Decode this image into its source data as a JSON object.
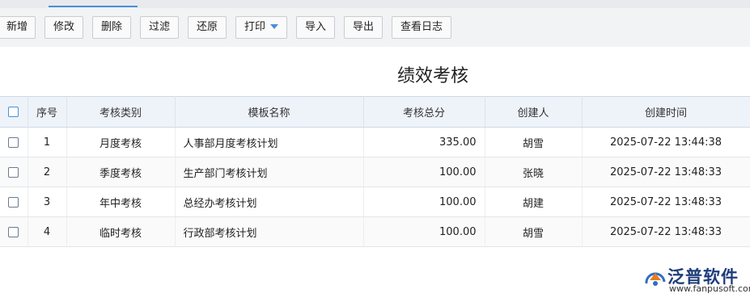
{
  "toolbar": {
    "buttons": [
      "新增",
      "修改",
      "删除",
      "过滤",
      "还原",
      "打印",
      "导入",
      "导出",
      "查看日志"
    ]
  },
  "page": {
    "title": "绩效考核"
  },
  "table": {
    "headers": [
      "序号",
      "考核类别",
      "模板名称",
      "考核总分",
      "创建人",
      "创建时间"
    ],
    "rows": [
      {
        "no": "1",
        "category": "月度考核",
        "template": "人事部月度考核计划",
        "score": "335.00",
        "creator": "胡雪",
        "time": "2025-07-22 13:44:38"
      },
      {
        "no": "2",
        "category": "季度考核",
        "template": "生产部门考核计划",
        "score": "100.00",
        "creator": "张晓",
        "time": "2025-07-22 13:48:33"
      },
      {
        "no": "3",
        "category": "年中考核",
        "template": "总经办考核计划",
        "score": "100.00",
        "creator": "胡建",
        "time": "2025-07-22 13:48:33"
      },
      {
        "no": "4",
        "category": "临时考核",
        "template": "行政部考核计划",
        "score": "100.00",
        "creator": "胡雪",
        "time": "2025-07-22 13:48:33"
      }
    ]
  },
  "logo": {
    "name": "泛普软件",
    "url": "www.fanpusoft.com",
    "icon": "fanpu-logo-icon"
  },
  "colors": {
    "accent": "#4a90d9",
    "link": "#3b7bc8",
    "header_bg": "#eef3fa",
    "toolbar_bg": "#f2f3f5"
  }
}
